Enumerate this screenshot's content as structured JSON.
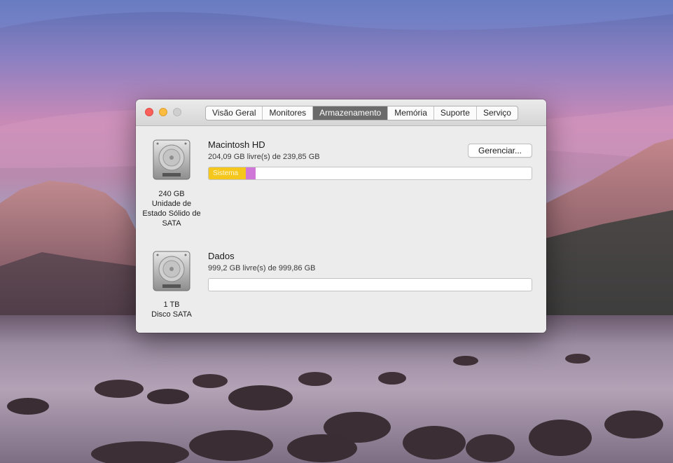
{
  "window": {
    "tabs": [
      {
        "label": "Visão Geral",
        "active": false
      },
      {
        "label": "Monitores",
        "active": false
      },
      {
        "label": "Armazenamento",
        "active": true
      },
      {
        "label": "Memória",
        "active": false
      },
      {
        "label": "Suporte",
        "active": false
      },
      {
        "label": "Serviço",
        "active": false
      }
    ]
  },
  "drives": [
    {
      "name": "Macintosh HD",
      "free_text": "204,09 GB livre(s) de 239,85 GB",
      "caption_lines": [
        "240 GB",
        "Unidade de",
        "Estado Sólido de",
        "SATA"
      ],
      "icon": "hard-drive-icon",
      "manage_label": "Gerenciar...",
      "usage": {
        "segments": [
          {
            "label": "Sistema",
            "fraction": 0.115,
            "color": "#f5c61b"
          },
          {
            "label": "",
            "fraction": 0.03,
            "color": "#cf78d8"
          }
        ]
      }
    },
    {
      "name": "Dados",
      "free_text": "999,2 GB livre(s) de 999,86 GB",
      "caption_lines": [
        "1 TB",
        "Disco SATA"
      ],
      "icon": "hard-drive-icon",
      "usage": {
        "segments": []
      }
    }
  ],
  "colors": {
    "active_tab": "#6b6b6b",
    "close": "#fc605b",
    "minimize": "#fdbc40",
    "zoom_disabled": "#cfcfcf"
  }
}
